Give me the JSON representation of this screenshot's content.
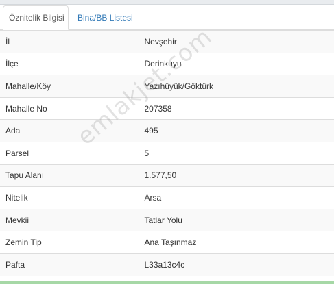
{
  "tabs": [
    {
      "label": "Öznitelik Bilgisi",
      "active": true
    },
    {
      "label": "Bina/BB Listesi",
      "active": false
    }
  ],
  "attributes": [
    {
      "key": "İl",
      "value": "Nevşehir"
    },
    {
      "key": "İlçe",
      "value": "Derinkuyu"
    },
    {
      "key": "Mahalle/Köy",
      "value": "Yazıhüyük/Göktürk"
    },
    {
      "key": "Mahalle No",
      "value": "207358"
    },
    {
      "key": "Ada",
      "value": "495"
    },
    {
      "key": "Parsel",
      "value": "5"
    },
    {
      "key": "Tapu Alanı",
      "value": "1.577,50"
    },
    {
      "key": "Nitelik",
      "value": "Arsa"
    },
    {
      "key": "Mevkii",
      "value": "Tatlar Yolu"
    },
    {
      "key": "Zemin Tip",
      "value": "Ana Taşınmaz"
    },
    {
      "key": "Pafta",
      "value": "L33a13c4c"
    }
  ],
  "watermark": "emlakjet.com",
  "colors": {
    "link": "#337ab7",
    "border": "#dddddd",
    "stripe": "#f9f9f9"
  }
}
